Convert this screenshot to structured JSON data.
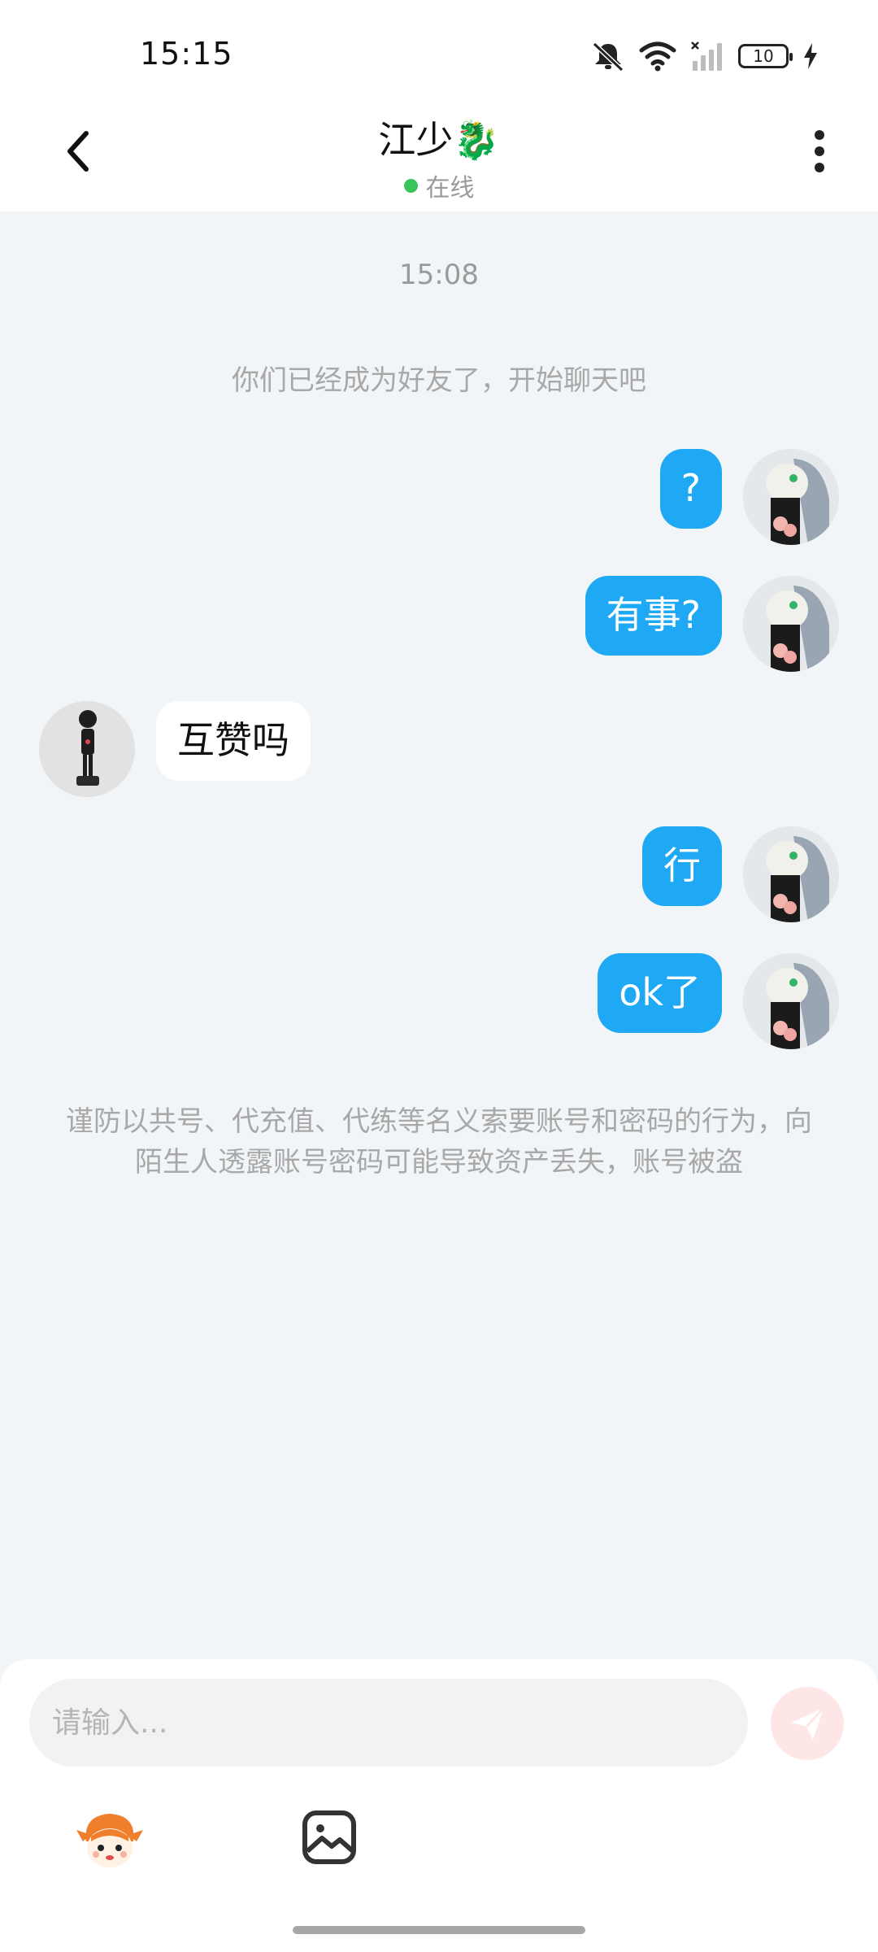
{
  "status_bar": {
    "time": "15:15",
    "battery": "10",
    "icons": [
      "mute-icon",
      "wifi-icon",
      "signal-icon",
      "battery-icon",
      "charging-icon"
    ]
  },
  "header": {
    "title": "江少🐉",
    "status": "在线",
    "icons": {
      "back": "chevron-left-icon",
      "more": "more-vertical-icon"
    },
    "colors": {
      "online": "#39C45A"
    }
  },
  "chat": {
    "timestamp": "15:08",
    "system_message": "你们已经成为好友了，开始聊天吧",
    "messages": [
      {
        "side": "right",
        "text": "?"
      },
      {
        "side": "right",
        "text": "有事?"
      },
      {
        "side": "left",
        "text": "互赞吗"
      },
      {
        "side": "right",
        "text": "行"
      },
      {
        "side": "right",
        "text": "ok了"
      }
    ],
    "notice": "谨防以共号、代充值、代练等名义索要账号和密码的行为，向陌生人透露账号密码可能导致资产丢失，账号被盗",
    "colors": {
      "my_bubble": "#1FA8F3",
      "their_bubble": "#FFFFFF",
      "background": "#F2F5F8"
    }
  },
  "input_bar": {
    "placeholder": "请输入...",
    "value": "",
    "icons": {
      "send": "send-icon",
      "emoji": "emoji-mascot-icon",
      "image": "image-icon"
    }
  }
}
